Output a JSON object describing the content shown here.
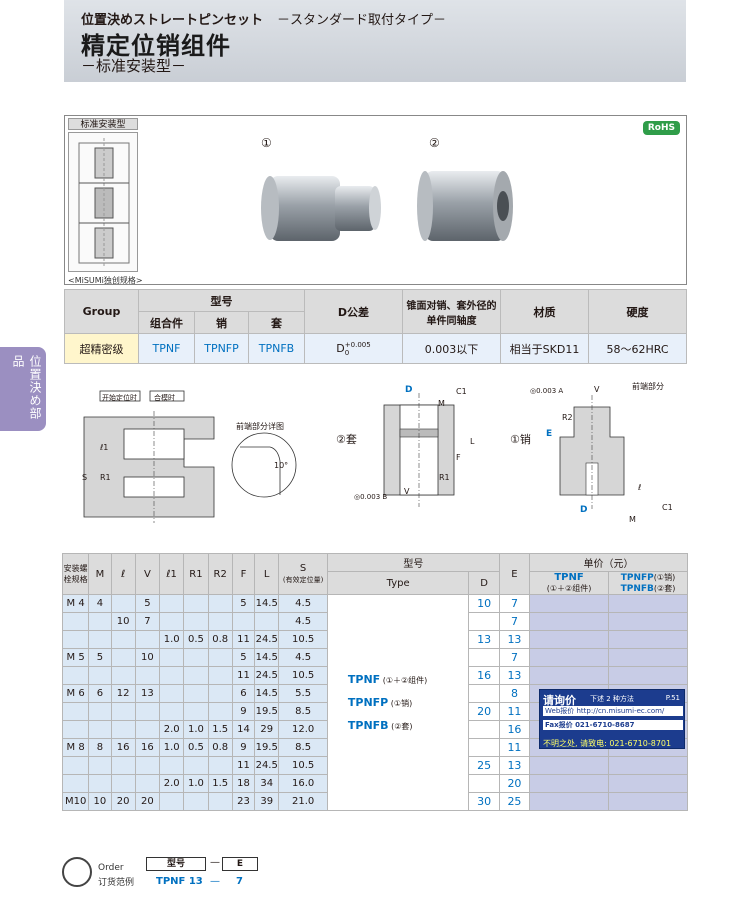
{
  "header": {
    "jp_title": "位置決めストレートピンセット",
    "jp_subtitle": "－スタンダード取付タイプ－",
    "title": "精定位销组件",
    "subtitle": "－标准安装型－"
  },
  "side_tab": "位置決め部品",
  "panel": {
    "sketch_label": "标准安装型",
    "label1": "①",
    "label2": "②",
    "rohs": "RoHS",
    "misumi_note": "<MiSUMi独创规格>"
  },
  "spec": {
    "group": "Group",
    "model": "型号",
    "combo": "组合件",
    "pin": "销",
    "sleeve": "套",
    "tol": "D公差",
    "coax": "锥面对销、套外径的单件同轴度",
    "material": "材质",
    "hardness": "硬度",
    "row": {
      "group": "超精密级",
      "combo": "TPNF",
      "pin": "TPNFP",
      "sleeve": "TPNFB",
      "tol": "D",
      "tol_sup": "+0.005",
      "tol_sub": "0",
      "coax": "0.003以下",
      "material": "相当于SKD11",
      "hardness": "58～62HRC"
    }
  },
  "drawings": {
    "start": "开始定位时",
    "closed": "合模时",
    "detail": "前端部分详图",
    "sleeve": "②套",
    "pin": "①销",
    "front": "前端部分",
    "angle": "10°",
    "c1": "C1",
    "m": "M",
    "r1": "R1",
    "r2": "R2",
    "s": "S",
    "l1": "ℓ1",
    "f": "F",
    "l": "ℓ",
    "big_l": "L",
    "d": "D",
    "e": "E",
    "v": "V",
    "flat": "◎0.003 A",
    "flat2": "◎0.003 B"
  },
  "price_table": {
    "headers": {
      "screw": "安装螺栓规格",
      "m": "M",
      "l": "ℓ",
      "v": "V",
      "l1": "ℓ1",
      "r1": "R1",
      "r2": "R2",
      "f": "F",
      "bigL": "L",
      "s": "S",
      "s_note": "(有效定位量)",
      "model": "型号",
      "type": "Type",
      "d": "D",
      "e": "E",
      "price": "单价（元）",
      "p1": "TPNF",
      "p1note": "(①＋②组件)",
      "p2": "TPNFP",
      "p2note": "(①销)",
      "p3": "TPNFB",
      "p3note": "(②套)"
    },
    "rows": [
      {
        "screw": "M 4",
        "m": "4",
        "l": "",
        "v": "5",
        "l1": "",
        "r1": "",
        "r2": "",
        "f": "5",
        "L": "14.5",
        "s": "4.5",
        "d": "10",
        "e": "7"
      },
      {
        "screw": "",
        "m": "",
        "l": "10",
        "v": "7",
        "l1": "",
        "r1": "",
        "r2": "",
        "f": "",
        "L": "",
        "s": "4.5",
        "d": "",
        "e": "7"
      },
      {
        "screw": "",
        "m": "",
        "l": "",
        "v": "",
        "l1": "1.0",
        "r1": "0.5",
        "r2": "0.8",
        "f": "11",
        "L": "24.5",
        "s": "10.5",
        "d": "13",
        "e": "13"
      },
      {
        "screw": "M 5",
        "m": "5",
        "l": "",
        "v": "10",
        "l1": "",
        "r1": "",
        "r2": "",
        "f": "5",
        "L": "14.5",
        "s": "4.5",
        "d": "",
        "e": "7"
      },
      {
        "screw": "",
        "m": "",
        "l": "",
        "v": "",
        "l1": "",
        "r1": "",
        "r2": "",
        "f": "11",
        "L": "24.5",
        "s": "10.5",
        "d": "16",
        "e": "13"
      },
      {
        "screw": "M 6",
        "m": "6",
        "l": "12",
        "v": "13",
        "l1": "",
        "r1": "",
        "r2": "",
        "f": "6",
        "L": "14.5",
        "s": "5.5",
        "d": "",
        "e": "8"
      },
      {
        "screw": "",
        "m": "",
        "l": "",
        "v": "",
        "l1": "",
        "r1": "",
        "r2": "",
        "f": "9",
        "L": "19.5",
        "s": "8.5",
        "d": "20",
        "e": "11"
      },
      {
        "screw": "",
        "m": "",
        "l": "",
        "v": "",
        "l1": "2.0",
        "r1": "1.0",
        "r2": "1.5",
        "f": "14",
        "L": "29",
        "s": "12.0",
        "d": "",
        "e": "16"
      },
      {
        "screw": "M 8",
        "m": "8",
        "l": "16",
        "v": "16",
        "l1": "1.0",
        "r1": "0.5",
        "r2": "0.8",
        "f": "9",
        "L": "19.5",
        "s": "8.5",
        "d": "",
        "e": "11"
      },
      {
        "screw": "",
        "m": "",
        "l": "",
        "v": "",
        "l1": "",
        "r1": "",
        "r2": "",
        "f": "11",
        "L": "24.5",
        "s": "10.5",
        "d": "25",
        "e": "13"
      },
      {
        "screw": "",
        "m": "",
        "l": "",
        "v": "",
        "l1": "2.0",
        "r1": "1.0",
        "r2": "1.5",
        "f": "18",
        "L": "34",
        "s": "16.0",
        "d": "",
        "e": "20"
      },
      {
        "screw": "M10",
        "m": "10",
        "l": "20",
        "v": "20",
        "l1": "",
        "r1": "",
        "r2": "",
        "f": "23",
        "L": "39",
        "s": "21.0",
        "d": "30",
        "e": "25"
      }
    ],
    "types": [
      {
        "code": "TPNF",
        "note": "(①＋②组件)"
      },
      {
        "code": "TPNFP",
        "note": "(①销)"
      },
      {
        "code": "TPNFB",
        "note": "(②套)"
      }
    ]
  },
  "inquiry": {
    "title": "请询价",
    "sub": "下述 2 种方法",
    "page": "P.51",
    "web": "Web报价",
    "web_val": "http://cn.misumi-ec.com/",
    "fax": "Fax报价",
    "fax_val": "021-6710-8687",
    "foot": "不明之处, 请致电: 021-6710-8701"
  },
  "order": {
    "title_en": "Order",
    "title_cn": "订货范例",
    "col1": "型号",
    "dash": "—",
    "col2": "E",
    "val1": "TPNF 13",
    "val2": "—",
    "val3": "7"
  }
}
